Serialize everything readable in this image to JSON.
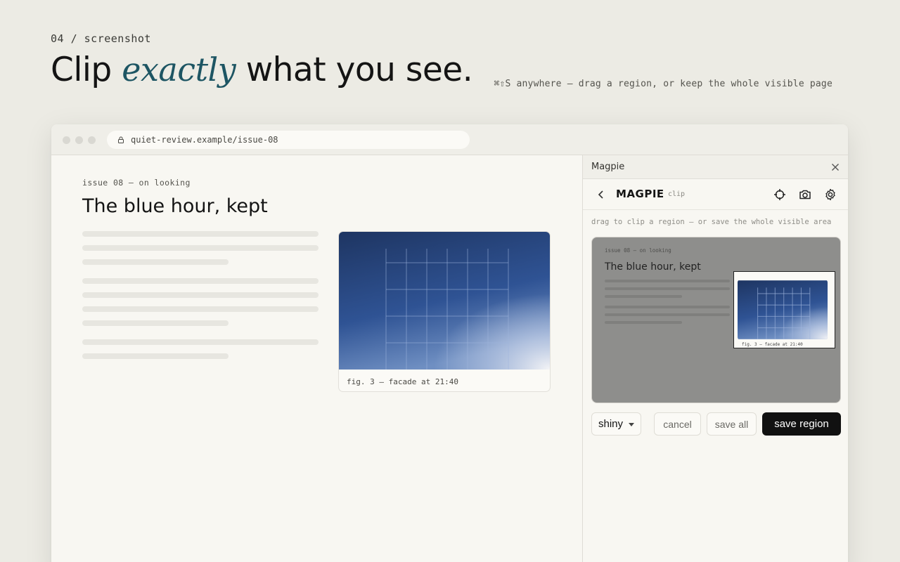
{
  "hero": {
    "eyebrow": "04 / screenshot",
    "headline_before": "Clip ",
    "headline_accent": "exactly",
    "headline_after": " what you see.",
    "shortcut_hint": "⌘⇧S anywhere — drag a region, or keep the whole visible page"
  },
  "browser": {
    "url": "quiet-review.example/issue-08"
  },
  "article": {
    "kicker": "issue 08 — on looking",
    "title": "The blue hour, kept",
    "figure_caption": "fig. 3 — facade at 21:40"
  },
  "panel": {
    "window_title": "Magpie",
    "brand": "MAGPIE",
    "brand_sub": "clip",
    "hint": "drag to clip a region — or save the whole visible area",
    "preview": {
      "kicker": "issue 08 — on looking",
      "title": "The blue hour, kept",
      "caption": "fig. 3 — facade at 21:40"
    },
    "style_select": "shiny",
    "cancel_label": "cancel",
    "save_all_label": "save all",
    "save_region_label": "save region"
  },
  "colors": {
    "accent": "#1d5563",
    "primary_button": "#111111",
    "sky_top": "#1e3a6e",
    "sky_bottom": "#6f8fc2"
  }
}
